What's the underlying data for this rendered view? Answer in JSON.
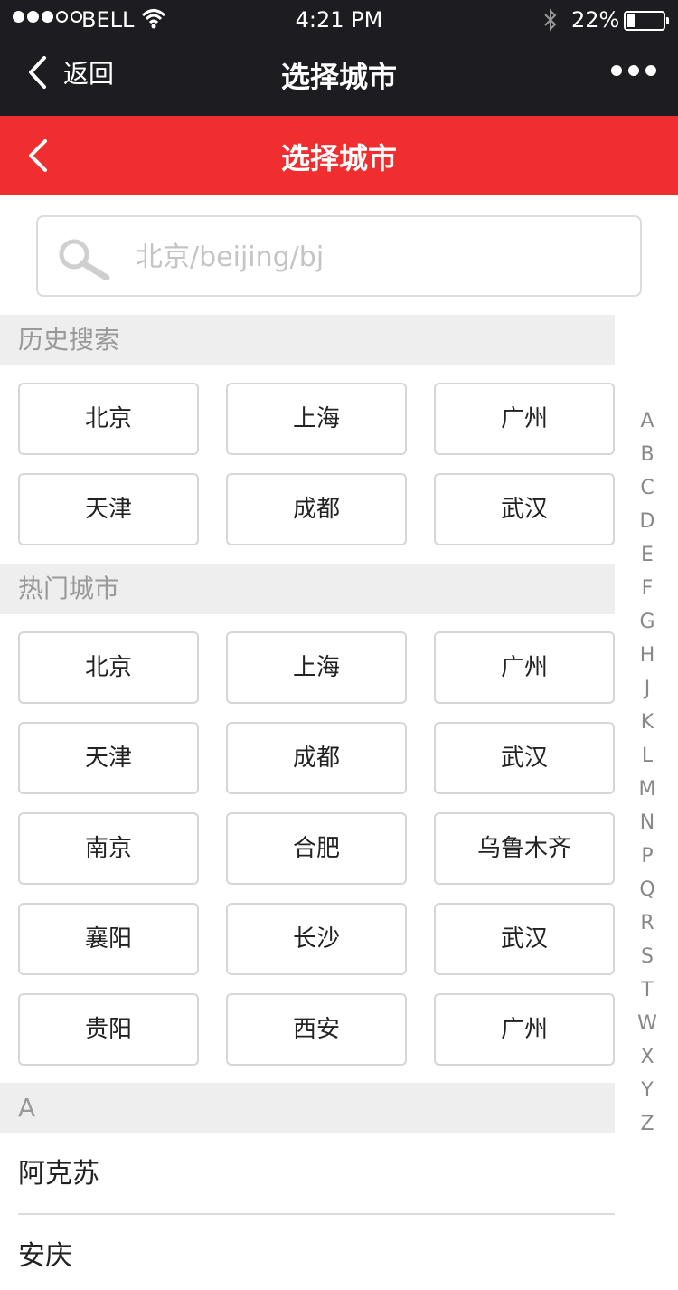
{
  "status_bar": {
    "carrier": "BELL",
    "time": "4:21 PM",
    "battery": "22%",
    "battery_level": 0.22,
    "signal_bars_filled": 3,
    "signal_bars_total": 5
  },
  "nav": {
    "back_label": "返回",
    "title": "选择城市"
  },
  "header": {
    "title": "选择城市",
    "color": "#f02e30"
  },
  "search": {
    "placeholder": "北京/beijing/bj",
    "value": ""
  },
  "history": {
    "label": "历史搜索",
    "cities": [
      "北京",
      "上海",
      "广州",
      "天津",
      "成都",
      "武汉"
    ]
  },
  "hot": {
    "label": "热门城市",
    "cities": [
      "北京",
      "上海",
      "广州",
      "天津",
      "成都",
      "武汉",
      "南京",
      "合肥",
      "乌鲁木齐",
      "襄阳",
      "长沙",
      "武汉",
      "贵阳",
      "西安",
      "广州"
    ]
  },
  "group_a": {
    "label": "A",
    "cities": [
      "阿克苏",
      "安庆"
    ]
  },
  "index_letters": [
    "A",
    "B",
    "C",
    "D",
    "E",
    "F",
    "G",
    "H",
    "J",
    "K",
    "L",
    "M",
    "N",
    "P",
    "Q",
    "R",
    "S",
    "T",
    "W",
    "X",
    "Y",
    "Z"
  ]
}
